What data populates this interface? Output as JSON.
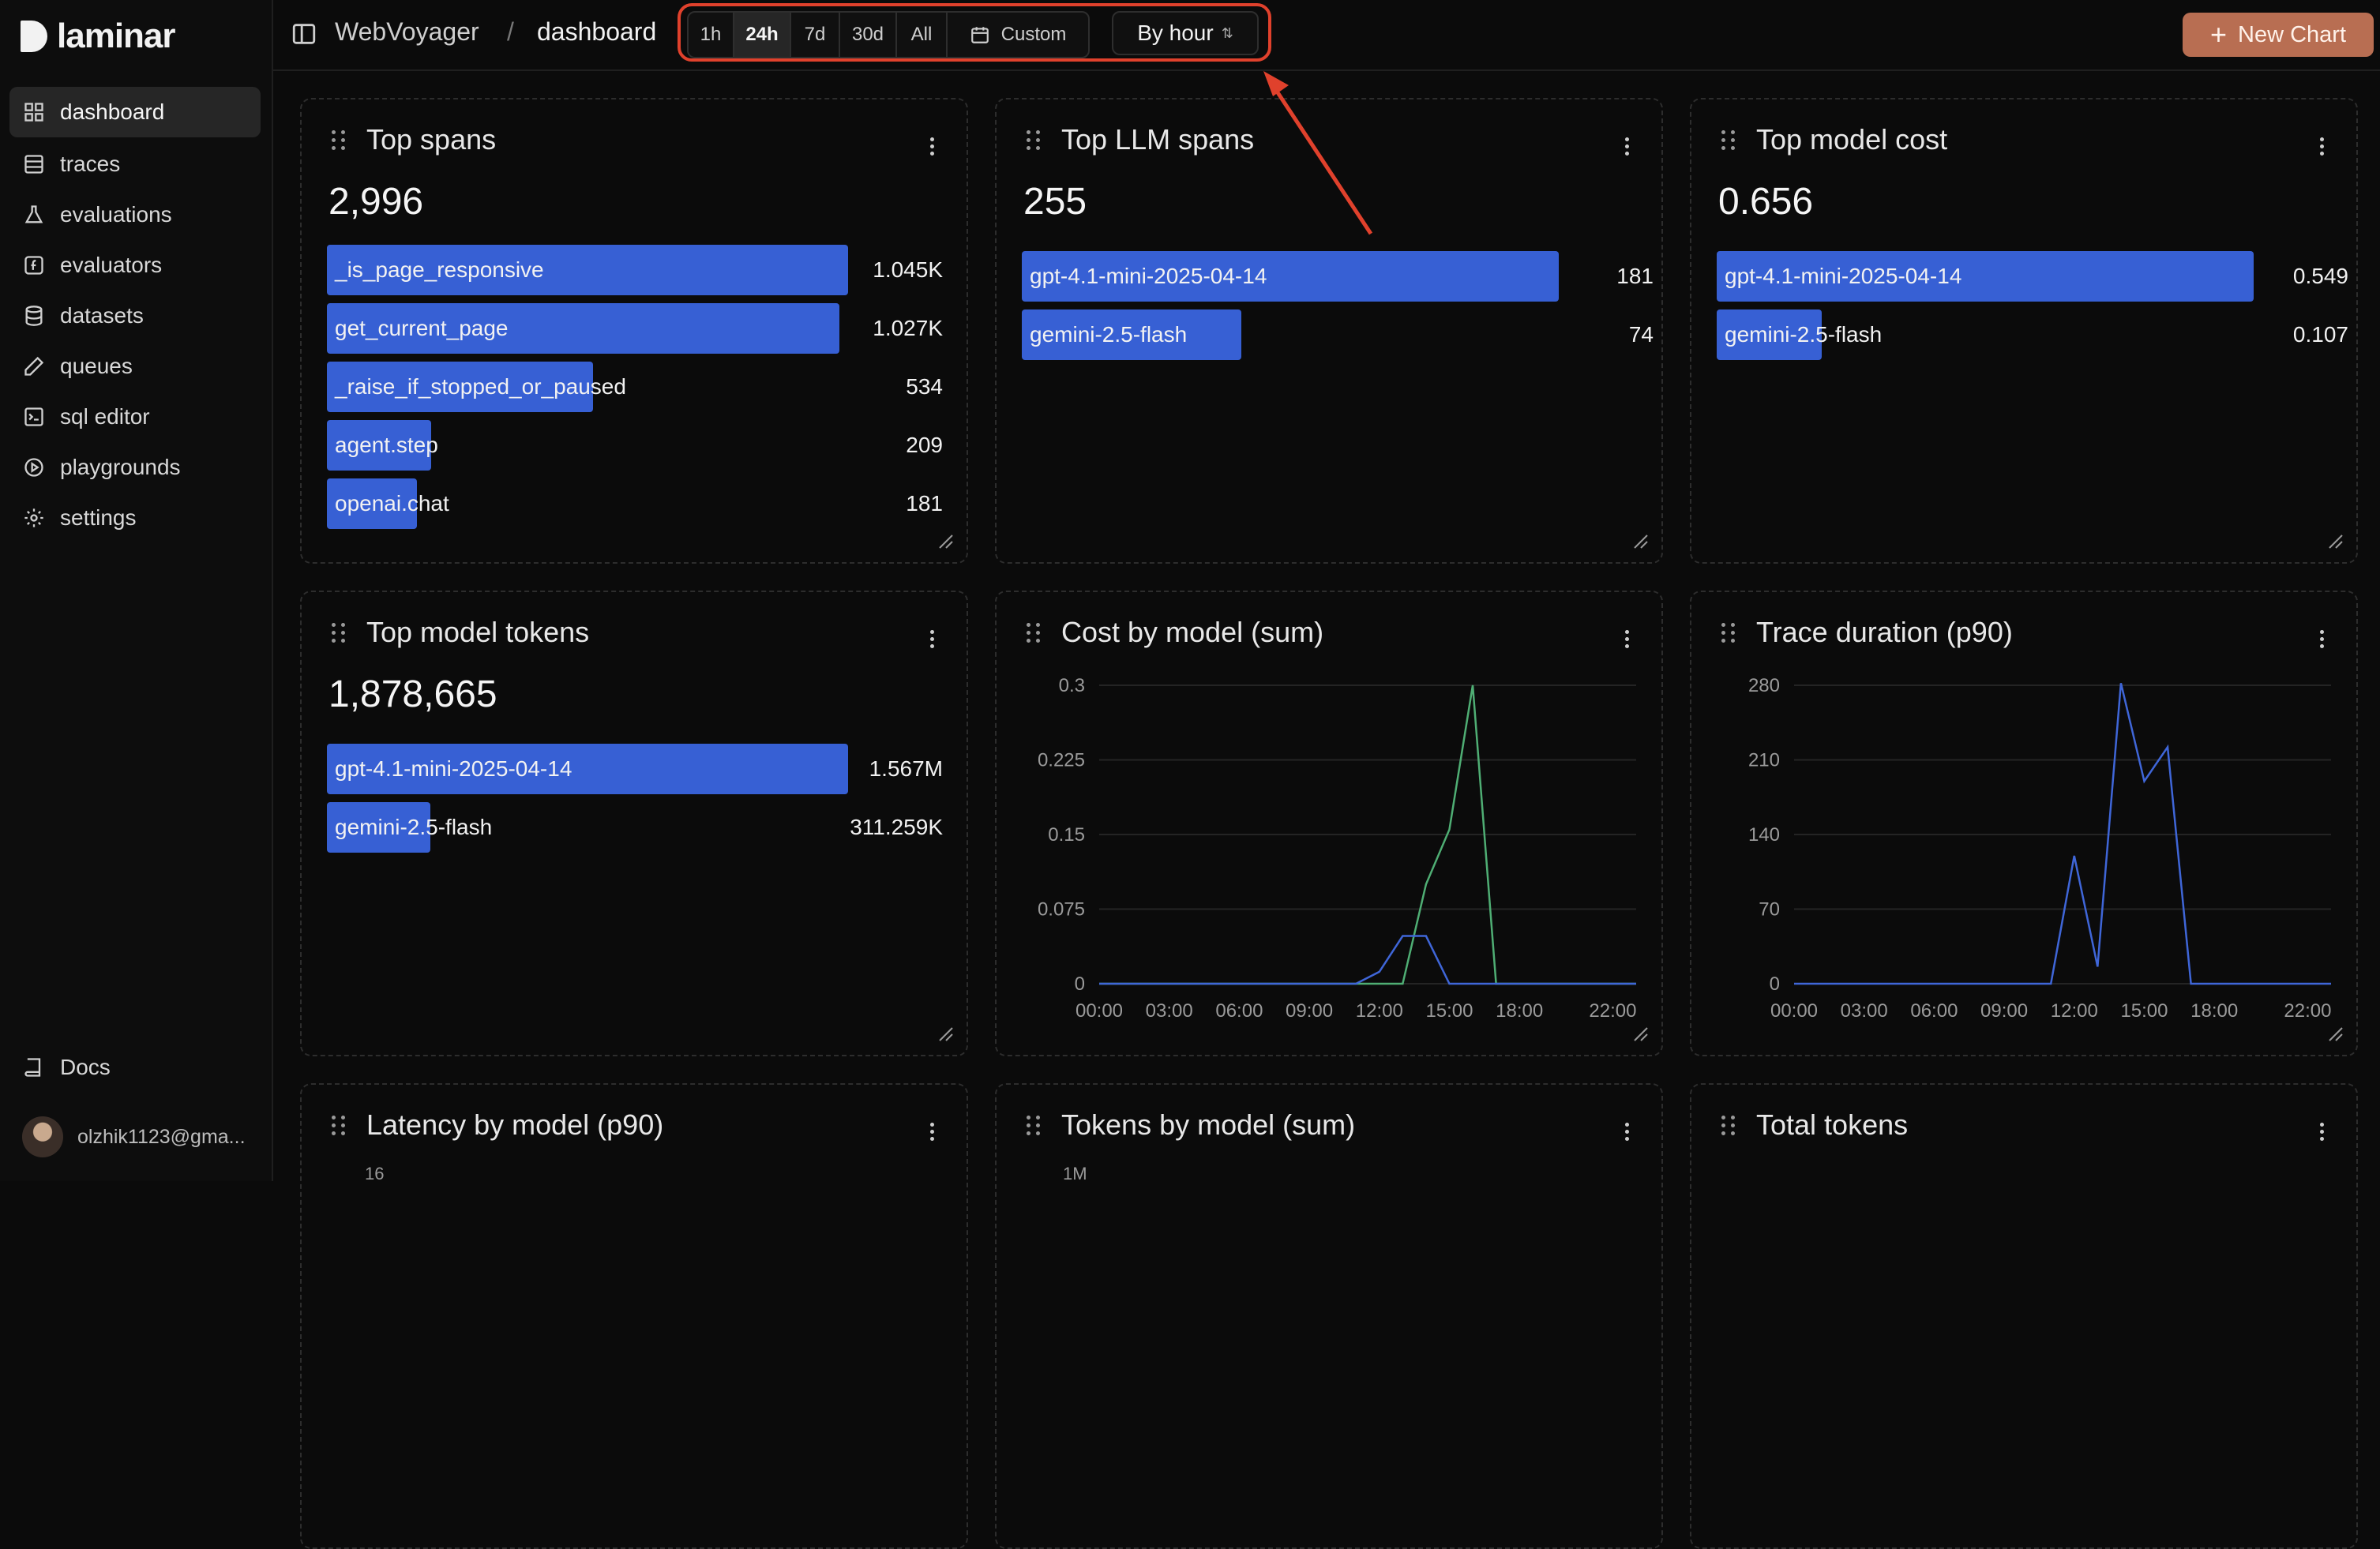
{
  "app": {
    "logo_text": "laminar"
  },
  "sidebar": {
    "items": [
      {
        "label": "dashboard",
        "icon": "dashboard-grid-icon",
        "active": true
      },
      {
        "label": "traces",
        "icon": "traces-list-icon"
      },
      {
        "label": "evaluations",
        "icon": "flask-icon"
      },
      {
        "label": "evaluators",
        "icon": "function-icon"
      },
      {
        "label": "datasets",
        "icon": "database-icon"
      },
      {
        "label": "queues",
        "icon": "pencil-icon"
      },
      {
        "label": "sql editor",
        "icon": "terminal-icon"
      },
      {
        "label": "playgrounds",
        "icon": "play-circle-icon"
      },
      {
        "label": "settings",
        "icon": "gear-icon"
      }
    ],
    "docs_label": "Docs",
    "user_email": "olzhik1123@gma..."
  },
  "topbar": {
    "project": "WebVoyager",
    "separator": "/",
    "page": "dashboard",
    "ranges": [
      "1h",
      "24h",
      "7d",
      "30d",
      "All"
    ],
    "active_range": "24h",
    "custom_label": "Custom",
    "group_by": "By hour",
    "new_chart_label": "New Chart",
    "highlight_color": "#e0412c"
  },
  "cards": {
    "top_spans": {
      "title": "Top spans",
      "total": "2,996",
      "rows": [
        {
          "label": "_is_page_responsive",
          "value": "1.045K",
          "fraction": 1.0
        },
        {
          "label": "get_current_page",
          "value": "1.027K",
          "fraction": 0.983
        },
        {
          "label": "_raise_if_stopped_or_paused",
          "value": "534",
          "fraction": 0.511
        },
        {
          "label": "agent.step",
          "value": "209",
          "fraction": 0.2
        },
        {
          "label": "openai.chat",
          "value": "181",
          "fraction": 0.173
        }
      ]
    },
    "top_llm_spans": {
      "title": "Top LLM spans",
      "total": "255",
      "rows": [
        {
          "label": "gpt-4.1-mini-2025-04-14",
          "value": "181",
          "fraction": 1.0
        },
        {
          "label": "gemini-2.5-flash",
          "value": "74",
          "fraction": 0.409
        }
      ]
    },
    "top_model_cost": {
      "title": "Top model cost",
      "total": "0.656",
      "rows": [
        {
          "label": "gpt-4.1-mini-2025-04-14",
          "value": "0.549",
          "fraction": 1.0
        },
        {
          "label": "gemini-2.5-flash",
          "value": "0.107",
          "fraction": 0.195
        }
      ]
    },
    "top_model_tokens": {
      "title": "Top model tokens",
      "total": "1,878,665",
      "rows": [
        {
          "label": "gpt-4.1-mini-2025-04-14",
          "value": "1.567M",
          "fraction": 1.0
        },
        {
          "label": "gemini-2.5-flash",
          "value": "311.259K",
          "fraction": 0.199
        }
      ]
    },
    "cost_by_model": {
      "title": "Cost by model (sum)"
    },
    "trace_duration": {
      "title": "Trace duration (p90)"
    },
    "latency_by_model": {
      "title": "Latency by model (p90)",
      "first_tick": "16"
    },
    "tokens_by_model": {
      "title": "Tokens by model (sum)",
      "first_tick": "1M"
    },
    "total_tokens": {
      "title": "Total tokens"
    }
  },
  "chart_data": [
    {
      "type": "line",
      "title": "Cost by model (sum)",
      "xlabel": "",
      "ylabel": "",
      "x_ticks": [
        "00:00",
        "03:00",
        "06:00",
        "09:00",
        "12:00",
        "15:00",
        "18:00",
        "22:00"
      ],
      "y_ticks": [
        "0",
        "0.075",
        "0.15",
        "0.225",
        "0.3"
      ],
      "ylim": [
        0,
        0.3
      ],
      "grid": true,
      "x": [
        0,
        1,
        2,
        3,
        4,
        5,
        6,
        7,
        8,
        9,
        10,
        11,
        12,
        13,
        14,
        15,
        16,
        17,
        18,
        19,
        20,
        21,
        22,
        23
      ],
      "series": [
        {
          "color": "#4fae74",
          "values": [
            0,
            0,
            0,
            0,
            0,
            0,
            0,
            0,
            0,
            0,
            0,
            0,
            0,
            0,
            0.1,
            0.155,
            0.3,
            0,
            0,
            0,
            0,
            0,
            0,
            0
          ]
        },
        {
          "color": "#3f66d8",
          "values": [
            0,
            0,
            0,
            0,
            0,
            0,
            0,
            0,
            0,
            0,
            0,
            0,
            0.012,
            0.048,
            0.048,
            0,
            0,
            0,
            0,
            0,
            0,
            0,
            0,
            0
          ]
        }
      ]
    },
    {
      "type": "line",
      "title": "Trace duration (p90)",
      "xlabel": "",
      "ylabel": "",
      "x_ticks": [
        "00:00",
        "03:00",
        "06:00",
        "09:00",
        "12:00",
        "15:00",
        "18:00",
        "22:00"
      ],
      "y_ticks": [
        "0",
        "70",
        "140",
        "210",
        "280"
      ],
      "ylim": [
        0,
        280
      ],
      "grid": true,
      "x": [
        0,
        1,
        2,
        3,
        4,
        5,
        6,
        7,
        8,
        9,
        10,
        11,
        12,
        13,
        14,
        15,
        16,
        17,
        18,
        19,
        20,
        21,
        22,
        23
      ],
      "series": [
        {
          "color": "#3f66d8",
          "values": [
            0,
            0,
            0,
            0,
            0,
            0,
            0,
            0,
            0,
            0,
            0,
            0,
            120,
            16,
            282,
            190,
            222,
            0,
            0,
            0,
            0,
            0,
            0,
            0
          ]
        }
      ]
    }
  ]
}
